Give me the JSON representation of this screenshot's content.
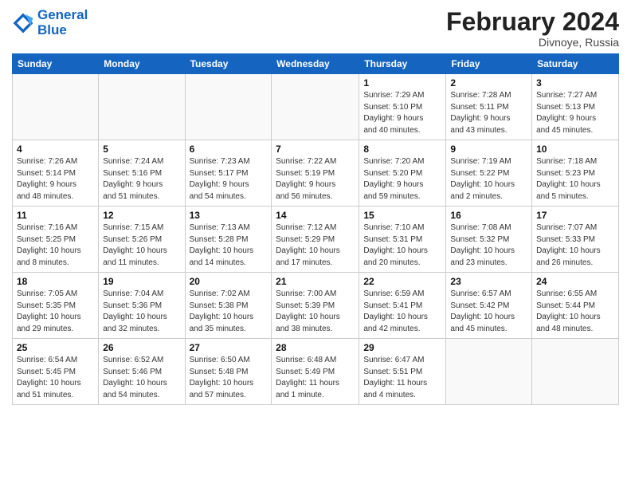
{
  "header": {
    "logo_line1": "General",
    "logo_line2": "Blue",
    "month_title": "February 2024",
    "location": "Divnoye, Russia"
  },
  "weekdays": [
    "Sunday",
    "Monday",
    "Tuesday",
    "Wednesday",
    "Thursday",
    "Friday",
    "Saturday"
  ],
  "weeks": [
    [
      {
        "day": "",
        "info": ""
      },
      {
        "day": "",
        "info": ""
      },
      {
        "day": "",
        "info": ""
      },
      {
        "day": "",
        "info": ""
      },
      {
        "day": "1",
        "info": "Sunrise: 7:29 AM\nSunset: 5:10 PM\nDaylight: 9 hours\nand 40 minutes."
      },
      {
        "day": "2",
        "info": "Sunrise: 7:28 AM\nSunset: 5:11 PM\nDaylight: 9 hours\nand 43 minutes."
      },
      {
        "day": "3",
        "info": "Sunrise: 7:27 AM\nSunset: 5:13 PM\nDaylight: 9 hours\nand 45 minutes."
      }
    ],
    [
      {
        "day": "4",
        "info": "Sunrise: 7:26 AM\nSunset: 5:14 PM\nDaylight: 9 hours\nand 48 minutes."
      },
      {
        "day": "5",
        "info": "Sunrise: 7:24 AM\nSunset: 5:16 PM\nDaylight: 9 hours\nand 51 minutes."
      },
      {
        "day": "6",
        "info": "Sunrise: 7:23 AM\nSunset: 5:17 PM\nDaylight: 9 hours\nand 54 minutes."
      },
      {
        "day": "7",
        "info": "Sunrise: 7:22 AM\nSunset: 5:19 PM\nDaylight: 9 hours\nand 56 minutes."
      },
      {
        "day": "8",
        "info": "Sunrise: 7:20 AM\nSunset: 5:20 PM\nDaylight: 9 hours\nand 59 minutes."
      },
      {
        "day": "9",
        "info": "Sunrise: 7:19 AM\nSunset: 5:22 PM\nDaylight: 10 hours\nand 2 minutes."
      },
      {
        "day": "10",
        "info": "Sunrise: 7:18 AM\nSunset: 5:23 PM\nDaylight: 10 hours\nand 5 minutes."
      }
    ],
    [
      {
        "day": "11",
        "info": "Sunrise: 7:16 AM\nSunset: 5:25 PM\nDaylight: 10 hours\nand 8 minutes."
      },
      {
        "day": "12",
        "info": "Sunrise: 7:15 AM\nSunset: 5:26 PM\nDaylight: 10 hours\nand 11 minutes."
      },
      {
        "day": "13",
        "info": "Sunrise: 7:13 AM\nSunset: 5:28 PM\nDaylight: 10 hours\nand 14 minutes."
      },
      {
        "day": "14",
        "info": "Sunrise: 7:12 AM\nSunset: 5:29 PM\nDaylight: 10 hours\nand 17 minutes."
      },
      {
        "day": "15",
        "info": "Sunrise: 7:10 AM\nSunset: 5:31 PM\nDaylight: 10 hours\nand 20 minutes."
      },
      {
        "day": "16",
        "info": "Sunrise: 7:08 AM\nSunset: 5:32 PM\nDaylight: 10 hours\nand 23 minutes."
      },
      {
        "day": "17",
        "info": "Sunrise: 7:07 AM\nSunset: 5:33 PM\nDaylight: 10 hours\nand 26 minutes."
      }
    ],
    [
      {
        "day": "18",
        "info": "Sunrise: 7:05 AM\nSunset: 5:35 PM\nDaylight: 10 hours\nand 29 minutes."
      },
      {
        "day": "19",
        "info": "Sunrise: 7:04 AM\nSunset: 5:36 PM\nDaylight: 10 hours\nand 32 minutes."
      },
      {
        "day": "20",
        "info": "Sunrise: 7:02 AM\nSunset: 5:38 PM\nDaylight: 10 hours\nand 35 minutes."
      },
      {
        "day": "21",
        "info": "Sunrise: 7:00 AM\nSunset: 5:39 PM\nDaylight: 10 hours\nand 38 minutes."
      },
      {
        "day": "22",
        "info": "Sunrise: 6:59 AM\nSunset: 5:41 PM\nDaylight: 10 hours\nand 42 minutes."
      },
      {
        "day": "23",
        "info": "Sunrise: 6:57 AM\nSunset: 5:42 PM\nDaylight: 10 hours\nand 45 minutes."
      },
      {
        "day": "24",
        "info": "Sunrise: 6:55 AM\nSunset: 5:44 PM\nDaylight: 10 hours\nand 48 minutes."
      }
    ],
    [
      {
        "day": "25",
        "info": "Sunrise: 6:54 AM\nSunset: 5:45 PM\nDaylight: 10 hours\nand 51 minutes."
      },
      {
        "day": "26",
        "info": "Sunrise: 6:52 AM\nSunset: 5:46 PM\nDaylight: 10 hours\nand 54 minutes."
      },
      {
        "day": "27",
        "info": "Sunrise: 6:50 AM\nSunset: 5:48 PM\nDaylight: 10 hours\nand 57 minutes."
      },
      {
        "day": "28",
        "info": "Sunrise: 6:48 AM\nSunset: 5:49 PM\nDaylight: 11 hours\nand 1 minute."
      },
      {
        "day": "29",
        "info": "Sunrise: 6:47 AM\nSunset: 5:51 PM\nDaylight: 11 hours\nand 4 minutes."
      },
      {
        "day": "",
        "info": ""
      },
      {
        "day": "",
        "info": ""
      }
    ]
  ]
}
